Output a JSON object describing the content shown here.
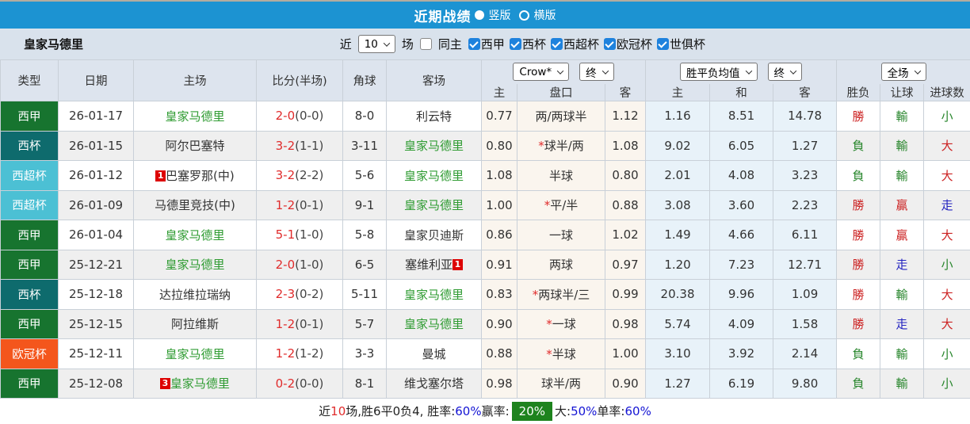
{
  "topbar": {
    "title": "近期战绩",
    "vertical": "竖版",
    "horizontal": "横版"
  },
  "filter": {
    "team": "皇家马德里",
    "near": "近",
    "count": "10",
    "games": "场",
    "same_home": "同主",
    "leagues": [
      "西甲",
      "西杯",
      "西超杯",
      "欧冠杯",
      "世俱杯"
    ]
  },
  "header": {
    "type": "类型",
    "date": "日期",
    "home": "主场",
    "score": "比分(半场)",
    "corner": "角球",
    "away": "客场",
    "dd_company": "Crow*",
    "dd_final1": "终",
    "dd_mean": "胜平负均值",
    "dd_final2": "终",
    "dd_scope": "全场",
    "sub": [
      "主",
      "盘口",
      "客",
      "主",
      "和",
      "客",
      "胜负",
      "让球",
      "进球数"
    ]
  },
  "type_colors": {
    "西甲": "#17742f",
    "西杯": "#0e6b6d",
    "西超杯": "#4cc0d4",
    "欧冠杯": "#f4561c"
  },
  "rows": [
    {
      "type": "西甲",
      "date": "26-01-17",
      "home": {
        "name": "皇家马德里",
        "green": true
      },
      "score": "2-0",
      "half": "(0-0)",
      "corner": "8-0",
      "away": {
        "name": "利云特",
        "green": false
      },
      "star": false,
      "odds": [
        "0.77",
        "两/两球半",
        "1.12"
      ],
      "mean": [
        "1.16",
        "8.51",
        "14.78"
      ],
      "results": [
        [
          "勝",
          "red"
        ],
        [
          "輸",
          "green"
        ],
        [
          "小",
          "green"
        ]
      ]
    },
    {
      "type": "西杯",
      "date": "26-01-15",
      "home": {
        "name": "阿尔巴塞特",
        "green": false
      },
      "score": "3-2",
      "half": "(1-1)",
      "corner": "3-11",
      "away": {
        "name": "皇家马德里",
        "green": true
      },
      "star": true,
      "odds": [
        "0.80",
        "球半/两",
        "1.08"
      ],
      "mean": [
        "9.02",
        "6.05",
        "1.27"
      ],
      "results": [
        [
          "負",
          "green"
        ],
        [
          "輸",
          "green"
        ],
        [
          "大",
          "red"
        ]
      ]
    },
    {
      "type": "西超杯",
      "date": "26-01-12",
      "home": {
        "name": "巴塞罗那(中)",
        "green": false,
        "badge": "1",
        "badge_pos": "before"
      },
      "score": "3-2",
      "half": "(2-2)",
      "corner": "5-6",
      "away": {
        "name": "皇家马德里",
        "green": true
      },
      "star": false,
      "odds": [
        "1.08",
        "半球",
        "0.80"
      ],
      "mean": [
        "2.01",
        "4.08",
        "3.23"
      ],
      "results": [
        [
          "負",
          "green"
        ],
        [
          "輸",
          "green"
        ],
        [
          "大",
          "red"
        ]
      ]
    },
    {
      "type": "西超杯",
      "date": "26-01-09",
      "home": {
        "name": "马德里竞技(中)",
        "green": false
      },
      "score": "1-2",
      "half": "(0-1)",
      "corner": "9-1",
      "away": {
        "name": "皇家马德里",
        "green": true
      },
      "star": true,
      "odds": [
        "1.00",
        "平/半",
        "0.88"
      ],
      "mean": [
        "3.08",
        "3.60",
        "2.23"
      ],
      "results": [
        [
          "勝",
          "red"
        ],
        [
          "贏",
          "red"
        ],
        [
          "走",
          "blue"
        ]
      ]
    },
    {
      "type": "西甲",
      "date": "26-01-04",
      "home": {
        "name": "皇家马德里",
        "green": true
      },
      "score": "5-1",
      "half": "(1-0)",
      "corner": "5-8",
      "away": {
        "name": "皇家贝迪斯",
        "green": false
      },
      "star": false,
      "odds": [
        "0.86",
        "一球",
        "1.02"
      ],
      "mean": [
        "1.49",
        "4.66",
        "6.11"
      ],
      "results": [
        [
          "勝",
          "red"
        ],
        [
          "贏",
          "red"
        ],
        [
          "大",
          "red"
        ]
      ]
    },
    {
      "type": "西甲",
      "date": "25-12-21",
      "home": {
        "name": "皇家马德里",
        "green": true
      },
      "score": "2-0",
      "half": "(1-0)",
      "corner": "6-5",
      "away": {
        "name": "塞维利亚",
        "green": false,
        "badge": "1",
        "badge_pos": "after"
      },
      "star": false,
      "odds": [
        "0.91",
        "两球",
        "0.97"
      ],
      "mean": [
        "1.20",
        "7.23",
        "12.71"
      ],
      "results": [
        [
          "勝",
          "red"
        ],
        [
          "走",
          "blue"
        ],
        [
          "小",
          "green"
        ]
      ]
    },
    {
      "type": "西杯",
      "date": "25-12-18",
      "home": {
        "name": "达拉维拉瑞纳",
        "green": false
      },
      "score": "2-3",
      "half": "(0-2)",
      "corner": "5-11",
      "away": {
        "name": "皇家马德里",
        "green": true
      },
      "star": true,
      "odds": [
        "0.83",
        "两球半/三",
        "0.99"
      ],
      "mean": [
        "20.38",
        "9.96",
        "1.09"
      ],
      "results": [
        [
          "勝",
          "red"
        ],
        [
          "輸",
          "green"
        ],
        [
          "大",
          "red"
        ]
      ]
    },
    {
      "type": "西甲",
      "date": "25-12-15",
      "home": {
        "name": "阿拉维斯",
        "green": false
      },
      "score": "1-2",
      "half": "(0-1)",
      "corner": "5-7",
      "away": {
        "name": "皇家马德里",
        "green": true
      },
      "star": true,
      "odds": [
        "0.90",
        "一球",
        "0.98"
      ],
      "mean": [
        "5.74",
        "4.09",
        "1.58"
      ],
      "results": [
        [
          "勝",
          "red"
        ],
        [
          "走",
          "blue"
        ],
        [
          "大",
          "red"
        ]
      ]
    },
    {
      "type": "欧冠杯",
      "date": "25-12-11",
      "home": {
        "name": "皇家马德里",
        "green": true
      },
      "score": "1-2",
      "half": "(1-2)",
      "corner": "3-3",
      "away": {
        "name": "曼城",
        "green": false
      },
      "star": true,
      "odds": [
        "0.88",
        "半球",
        "1.00"
      ],
      "mean": [
        "3.10",
        "3.92",
        "2.14"
      ],
      "results": [
        [
          "負",
          "green"
        ],
        [
          "輸",
          "green"
        ],
        [
          "小",
          "green"
        ]
      ]
    },
    {
      "type": "西甲",
      "date": "25-12-08",
      "home": {
        "name": "皇家马德里",
        "green": true,
        "badge": "3",
        "badge_pos": "before"
      },
      "score": "0-2",
      "half": "(0-0)",
      "corner": "8-1",
      "away": {
        "name": "维戈塞尔塔",
        "green": false
      },
      "star": false,
      "odds": [
        "0.98",
        "球半/两",
        "0.90"
      ],
      "mean": [
        "1.27",
        "6.19",
        "9.80"
      ],
      "results": [
        [
          "負",
          "green"
        ],
        [
          "輸",
          "green"
        ],
        [
          "小",
          "green"
        ]
      ]
    }
  ],
  "summary": {
    "segments": [
      {
        "text": "近",
        "style": "black"
      },
      {
        "text": "10",
        "style": "red"
      },
      {
        "text": "场,胜6平0负4, 胜率:",
        "style": "black"
      },
      {
        "text": "60%",
        "style": "blue"
      },
      {
        "text": " 赢率:",
        "style": "black"
      },
      {
        "text": "20%",
        "style": "greenbox"
      },
      {
        "text": " 大:",
        "style": "black"
      },
      {
        "text": "50%",
        "style": "blue"
      },
      {
        "text": " 单率:",
        "style": "black"
      },
      {
        "text": "60%",
        "style": "blue"
      }
    ]
  }
}
